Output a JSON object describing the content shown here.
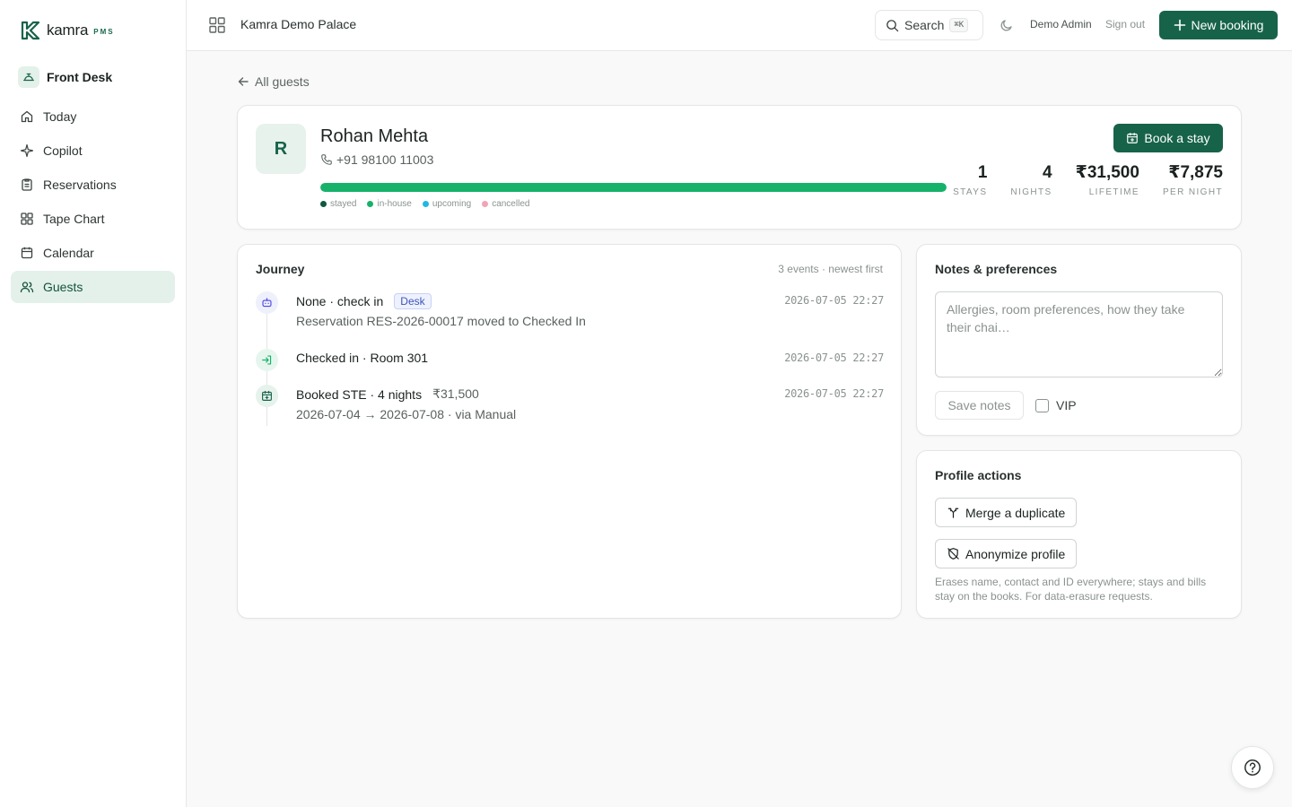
{
  "brand": {
    "name": "kamra",
    "suffix": "PMS"
  },
  "workspace": {
    "label": "Front Desk",
    "icon": "bell-desk-icon"
  },
  "nav": [
    {
      "label": "Today",
      "icon": "home-icon",
      "active": false
    },
    {
      "label": "Copilot",
      "icon": "sparkle-icon",
      "active": false
    },
    {
      "label": "Reservations",
      "icon": "clipboard-icon",
      "active": false
    },
    {
      "label": "Tape Chart",
      "icon": "grid-icon",
      "active": false
    },
    {
      "label": "Calendar",
      "icon": "calendar-icon",
      "active": false
    },
    {
      "label": "Guests",
      "icon": "users-icon",
      "active": true
    }
  ],
  "topbar": {
    "hotel": "Kamra Demo Palace",
    "search_label": "Search",
    "search_shortcut": "⌘K",
    "user": "Demo Admin",
    "signout": "Sign out",
    "new_booking": "New booking"
  },
  "back_link": "All guests",
  "guest": {
    "initial": "R",
    "name": "Rohan Mehta",
    "phone": "+91 98100 11003",
    "book_button": "Book a stay",
    "stay_mix": {
      "in_house_fraction": 1.0
    },
    "legend": [
      {
        "label": "stayed",
        "color": "#0f5a3f"
      },
      {
        "label": "in-house",
        "color": "#17b26a"
      },
      {
        "label": "upcoming",
        "color": "#1fb8e3"
      },
      {
        "label": "cancelled",
        "color": "#f4a3b4"
      }
    ],
    "stats": [
      {
        "value": "1",
        "label": "STAYS"
      },
      {
        "value": "4",
        "label": "NIGHTS"
      },
      {
        "value": "₹31,500",
        "label": "LIFETIME"
      },
      {
        "value": "₹7,875",
        "label": "PER NIGHT"
      }
    ]
  },
  "journey": {
    "title": "Journey",
    "meta": "3 events · newest first",
    "events": [
      {
        "title": "None · check in",
        "badge": "Desk",
        "subtitle": "Reservation RES-2026-00017 moved to Checked In",
        "time": "2026-07-05 22:27",
        "icon": "robot-icon",
        "color": "#4f46e5"
      },
      {
        "title": "Checked in · Room 301",
        "time": "2026-07-05 22:27",
        "icon": "sign-in-icon",
        "color": "#17b26a"
      },
      {
        "title": "Booked STE · 4 nights",
        "amount": "₹31,500",
        "subtitle": "2026-07-04 → 2026-07-08 · via Manual",
        "time": "2026-07-05 22:27",
        "icon": "calendar-plus-icon",
        "color": "#17634a"
      }
    ]
  },
  "notes": {
    "title": "Notes & preferences",
    "placeholder": "Allergies, room preferences, how they take their chai…",
    "save_label": "Save notes",
    "vip_label": "VIP",
    "vip_checked": false
  },
  "profile_actions": {
    "title": "Profile actions",
    "merge_label": "Merge a duplicate",
    "anonymize_label": "Anonymize profile",
    "hint": "Erases name, contact and ID everywhere; stays and bills stay on the books. For data-erasure requests."
  },
  "colors": {
    "accent": "#17634a",
    "accent_soft": "#e3f1ea",
    "in_house": "#17b26a"
  }
}
